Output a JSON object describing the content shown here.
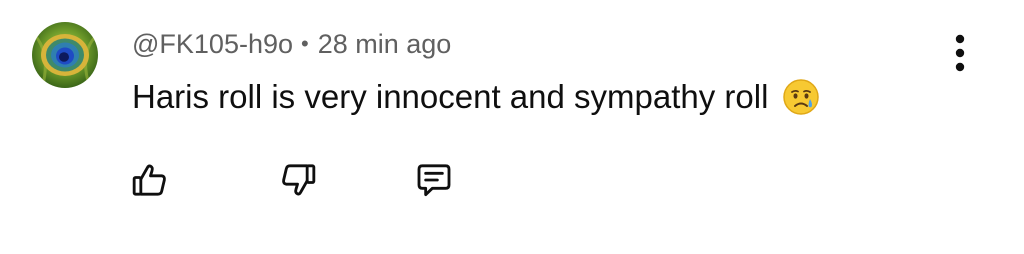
{
  "comment": {
    "author": "@FK105-h9o",
    "separator": "•",
    "timestamp": "28 min ago",
    "text": "Haris roll is very innocent and sympathy roll",
    "emoji": "crying-face"
  },
  "avatar": {
    "icon": "peacock-feather-avatar"
  },
  "actions": {
    "like_icon": "thumbs-up-icon",
    "dislike_icon": "thumbs-down-icon",
    "reply_icon": "comment-icon",
    "more_icon": "more-vert-icon"
  },
  "colors": {
    "text_primary": "#0f0f0f",
    "text_secondary": "#606060",
    "background": "#ffffff"
  }
}
